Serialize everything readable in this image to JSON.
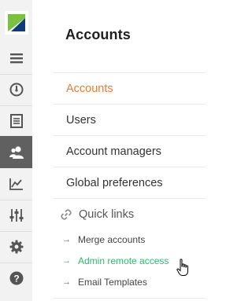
{
  "page": {
    "title": "Accounts"
  },
  "nav": {
    "items": [
      {
        "label": "Accounts",
        "active": true
      },
      {
        "label": "Users",
        "active": false
      },
      {
        "label": "Account managers",
        "active": false
      },
      {
        "label": "Global preferences",
        "active": false
      }
    ]
  },
  "quick_links": {
    "heading": "Quick links",
    "items": [
      {
        "label": "Merge accounts"
      },
      {
        "label": "Admin remote access"
      },
      {
        "label": "Email Templates"
      }
    ]
  },
  "rail": {
    "icons": [
      "logo-icon",
      "hamburger-menu-icon",
      "dashboard-gauge-icon",
      "document-icon",
      "users-icon",
      "analytics-chart-icon",
      "sliders-icon",
      "settings-gear-icon",
      "help-icon"
    ],
    "active": "users-icon"
  },
  "colors": {
    "accent_active": "#ec7b2c",
    "link_hover": "#2fb86b",
    "rail_bg": "#f2f2f2",
    "rail_active_bg": "#606060",
    "logo_green": "#7ac143",
    "logo_blue": "#0d3c7a"
  }
}
